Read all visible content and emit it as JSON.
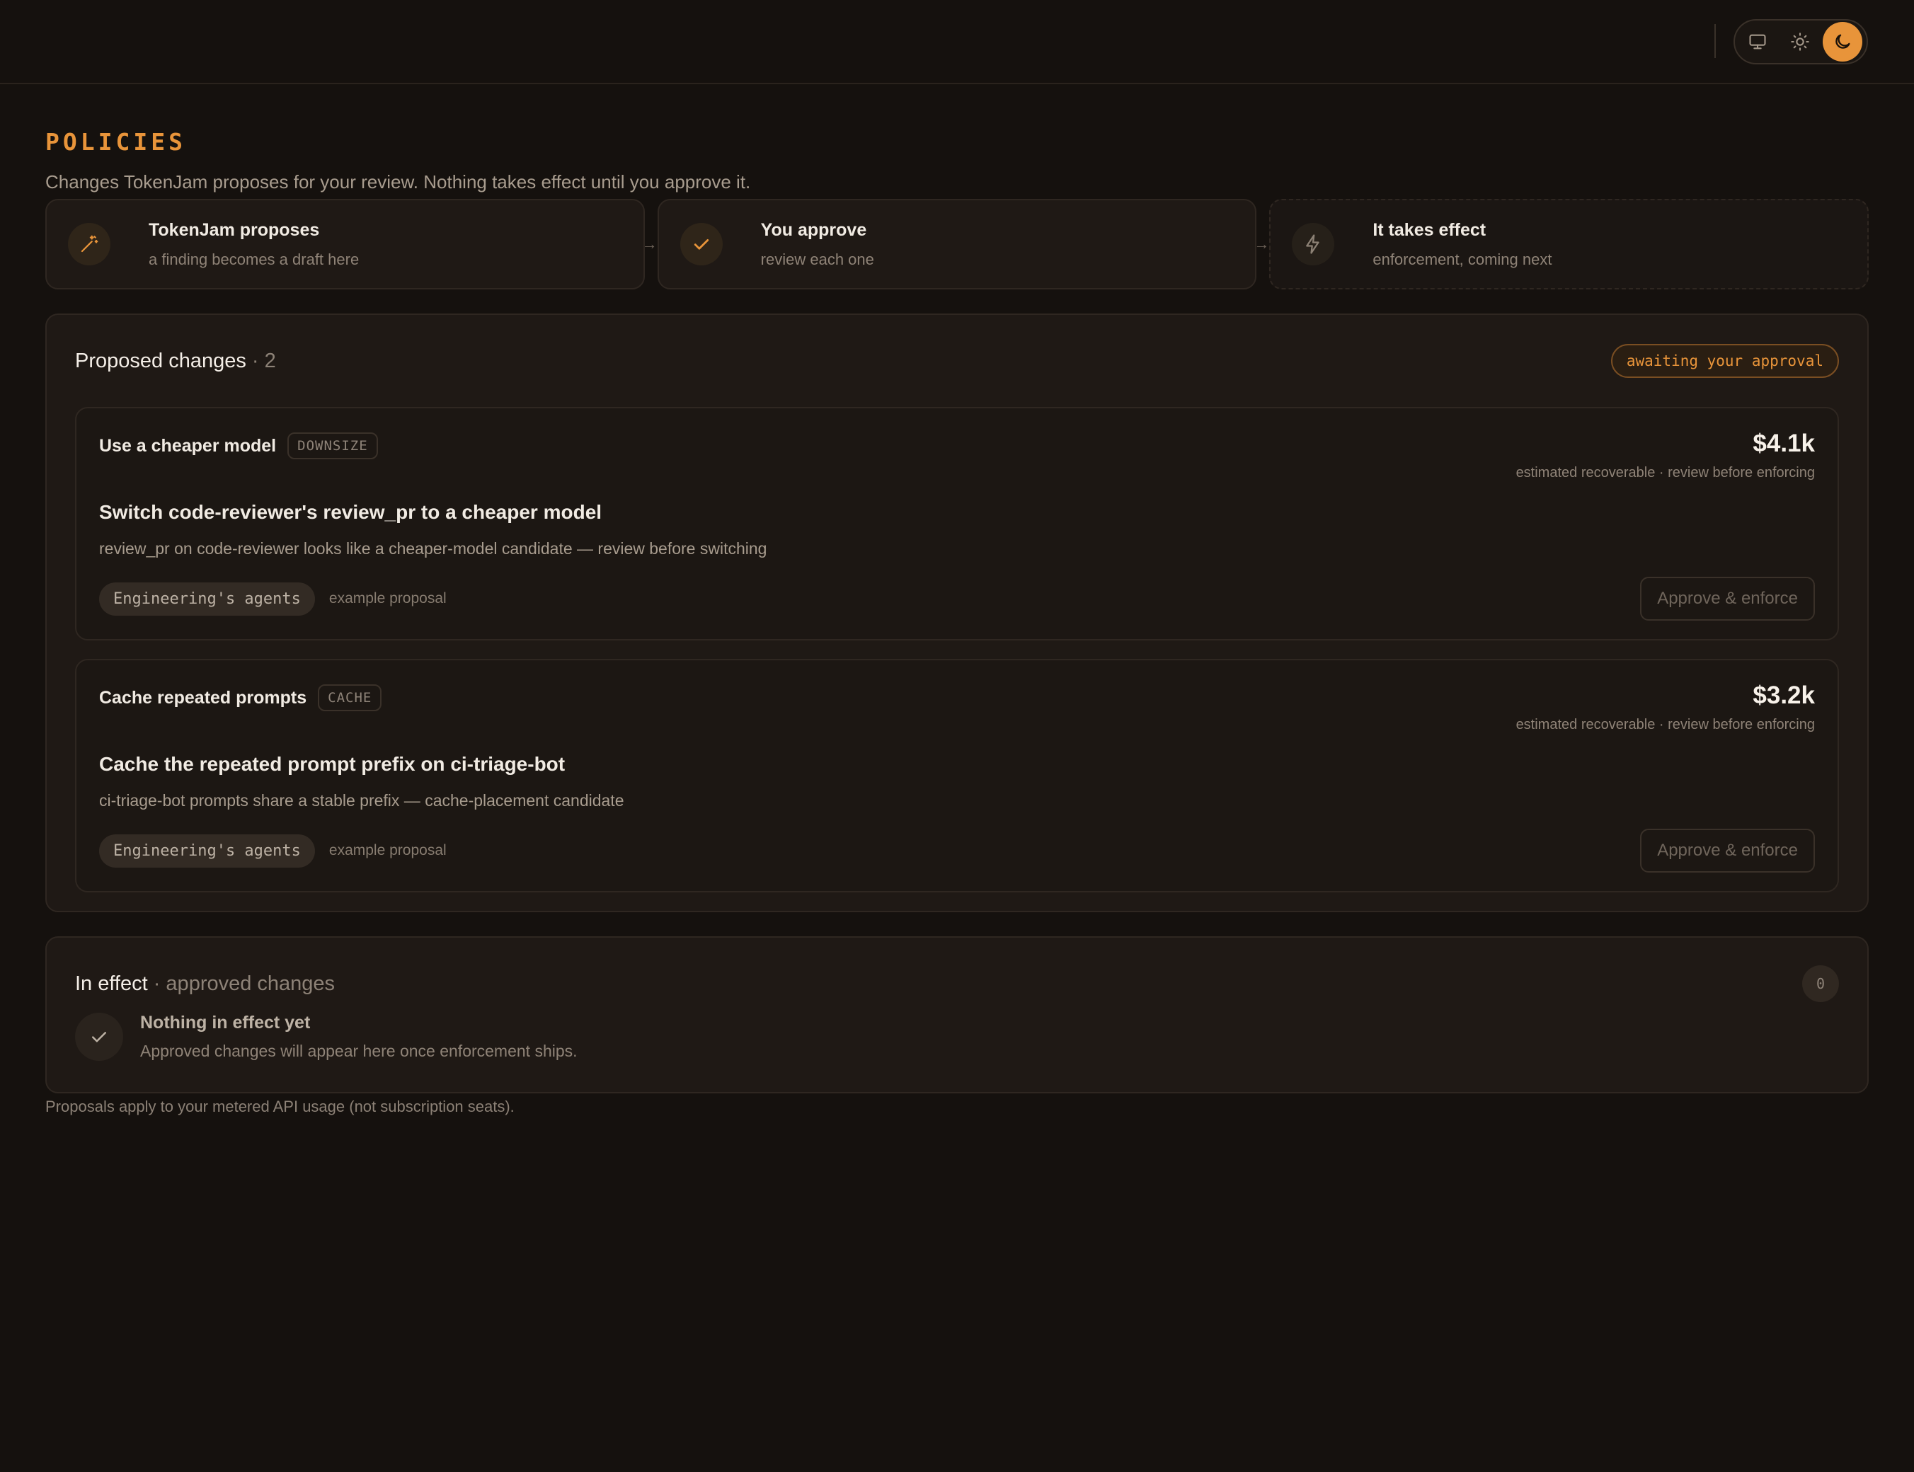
{
  "page": {
    "title": "POLICIES",
    "subtitle": "Changes TokenJam proposes for your review. Nothing takes effect until you approve it.",
    "footnote": "Proposals apply to your metered API usage (not subscription seats)."
  },
  "theme_switch": {
    "options": [
      {
        "icon": "monitor-icon",
        "active": false
      },
      {
        "icon": "sun-icon",
        "active": false
      },
      {
        "icon": "moon-icon",
        "active": true
      }
    ]
  },
  "steps": [
    {
      "title": "TokenJam proposes",
      "subtitle": "a finding becomes a draft here",
      "icon": "wand-icon"
    },
    {
      "title": "You approve",
      "subtitle": "review each one",
      "icon": "check-icon"
    },
    {
      "title": "It takes effect",
      "subtitle": "enforcement, coming next",
      "icon": "bolt-icon"
    }
  ],
  "proposed": {
    "title": "Proposed changes",
    "count": "· 2",
    "badge": "awaiting your approval",
    "cards": [
      {
        "kind": "Use a cheaper model",
        "tag": "DOWNSIZE",
        "amount": "$4.1k",
        "amount_note": "estimated recoverable · review before enforcing",
        "title": "Switch code-reviewer's review_pr to a cheaper model",
        "description": "review_pr on code-reviewer looks like a cheaper-model candidate — review before switching",
        "team": "Engineering's agents",
        "example_label": "example proposal",
        "action": "Approve & enforce"
      },
      {
        "kind": "Cache repeated prompts",
        "tag": "CACHE",
        "amount": "$3.2k",
        "amount_note": "estimated recoverable · review before enforcing",
        "title": "Cache the repeated prompt prefix on ci-triage-bot",
        "description": "ci-triage-bot prompts share a stable prefix — cache-placement candidate",
        "team": "Engineering's agents",
        "example_label": "example proposal",
        "action": "Approve & enforce"
      }
    ]
  },
  "in_effect": {
    "title": "In effect",
    "subtitle": "· approved changes",
    "count": "0",
    "empty_title": "Nothing in effect yet",
    "empty_subtitle": "Approved changes will appear here once enforcement ships."
  },
  "colors": {
    "background": "#15110e",
    "panel": "#1f1915",
    "accent": "#e8943a"
  }
}
